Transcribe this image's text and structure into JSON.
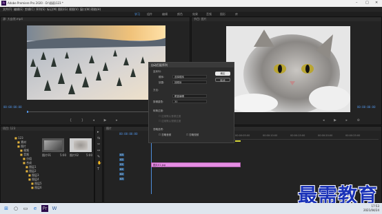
{
  "app": {
    "title": "Adobe Premiere Pro 2020 - D:\\插画\\123 *",
    "logo": "Pr"
  },
  "menu": [
    "文件(F)",
    "编辑(E)",
    "剪辑(C)",
    "序列(S)",
    "标记(M)",
    "图形(G)",
    "视图(V)",
    "窗口(W)",
    "帮助(H)"
  ],
  "workspaces": [
    "学习",
    "组件",
    "编辑",
    "颜色",
    "效果",
    "音频",
    "图形",
    "库"
  ],
  "source_monitor": {
    "header": "源: 大自然.mp4",
    "timecode": "00:00:00:00"
  },
  "program_monitor": {
    "header": "节目: 图片",
    "timecode": "00:00:00:00"
  },
  "project_panel": {
    "header": "项目: 123",
    "tree": [
      "123",
      "素材",
      "图片",
      "视频",
      "音频",
      "分组",
      "合成",
      "图层1",
      "图层2",
      "图层3",
      "图层4",
      "图层5",
      "图层6"
    ],
    "thumbs": [
      {
        "name": "图片01",
        "dur": "5:00"
      },
      {
        "name": "图片02",
        "dur": "5:00"
      }
    ]
  },
  "timeline": {
    "header": "图片",
    "timecode": "00:00:00:00",
    "ruler": [
      "00:00:05:00",
      "00:00:10:00",
      "00:00:15:00",
      "00:00:20:00",
      "00:00:25:00"
    ],
    "tracks": [
      "V3",
      "V2",
      "V1",
      "A1",
      "A2",
      "A3"
    ],
    "clip_label": "图片01.jpg",
    "clip_color": "#e58ee3"
  },
  "dialog": {
    "title": "自动匹配序列",
    "ok": "确定",
    "cancel": "取消",
    "section1": "至序列:",
    "order_label": "顺序:",
    "order_value": "选择顺序",
    "place_label": "放置:",
    "place_value": "按顺序",
    "method_label": "方法:",
    "method_value": "覆盖编辑",
    "clip_overlap_label": "剪辑重叠:",
    "clip_overlap_value": "30",
    "transition_section": "转换过渡:",
    "apply_audio": "应用默认音频过渡",
    "apply_video": "应用默认视频过渡",
    "ignore_section": "忽略选项:",
    "ignore_audio": "忽略音频",
    "ignore_video": "忽略视频"
  },
  "taskbar": {
    "time": "17:53",
    "date": "2021/04/24"
  },
  "watermark": "最需教育"
}
